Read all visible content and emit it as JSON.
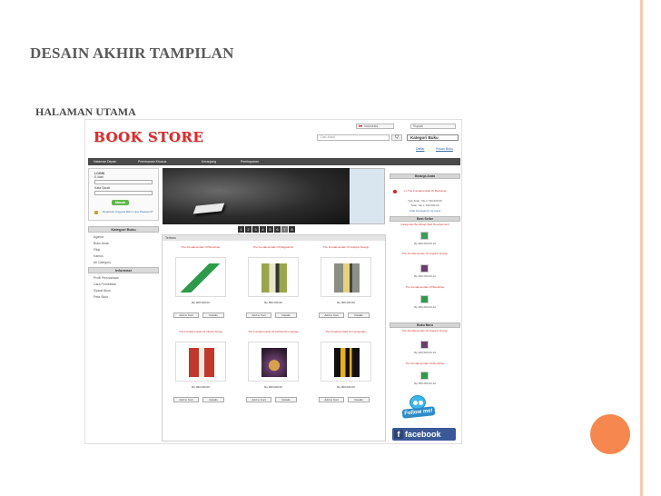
{
  "slide": {
    "title": "DESAIN AKHIR TAMPILAN",
    "subtitle": "HALAMAN UTAMA"
  },
  "store": {
    "logo": "BOOK STORE",
    "language": "Indonesia",
    "currency": "Rupiah",
    "search_placeholder": "Cari Judul",
    "search_button": "Q",
    "category_select": "Kategori Buku",
    "header_links": [
      "Daftar",
      "Pesan Buku"
    ],
    "nav": [
      "Halaman Depan",
      "Pemesanan Khusus",
      "Keranjang",
      "Pembayaran"
    ],
    "login": {
      "title": "LOGIN",
      "email_label": "E-Mail",
      "password_label": "Kata Sandi",
      "button": "Masuk",
      "register_text": "Registrasi Anggota Baru Lupa Password?"
    },
    "category_box": {
      "title": "Kategori Buku",
      "items": [
        "Agama",
        "Buku Anak",
        "Fiksi",
        "Kamus",
        "All Category"
      ]
    },
    "info_box": {
      "title": "Informasi",
      "items": [
        "Profil Perusahaan",
        "Cara Pembelian",
        "Syarat Akun",
        "Peta Situs"
      ]
    },
    "slideshow_pages": [
      "1",
      "2",
      "3",
      "4",
      "5",
      "6",
      "7",
      "8"
    ],
    "products_heading": "Terbaru",
    "products": [
      {
        "title": "The Fundamentals Of Bootstrap",
        "price": "Rp.000.000.00",
        "cover_color": "#2e9b4a"
      },
      {
        "title": "The Fundamentals Of Magical Art",
        "price": "Rp.000.000.00",
        "cover_color": "#9aa64b"
      },
      {
        "title": "The Fundamentals Of Graphic Design",
        "price": "Rp.000.000.00",
        "cover_color": "#8c8f86"
      },
      {
        "title": "The Fundamentals Of Interior Desig",
        "price": "Rp.000.000.00",
        "cover_color": "#c0392b"
      },
      {
        "title": "The Fundamentals Of Architecture Design",
        "price": "Rp.000.000.00",
        "cover_color": "#6b3f6d"
      },
      {
        "title": "The Fundamentals Of Typography",
        "price": "Rp.000.000.00",
        "cover_color": "#e6b01e"
      }
    ],
    "add_to_cart": "Add to Cart",
    "detail": "Details",
    "right": {
      "cart_title": "Belanja Anda",
      "cart_line": "1 x The Fundamentals Of Bootstrap",
      "subtotal": "Sub-Total : Rp.1.700.000.00",
      "total": "Total : Rp.1.700.000.00",
      "cart_link": "Lihat Keranjang | Ke Kasir",
      "bestseller_title": "Best Seller",
      "bestseller_items": [
        {
          "title": "Categories Bootstrap Web Development",
          "price": "Rp.000.000.00.12",
          "color": "#3a9d5a"
        },
        {
          "title": "The Fundamentals Of Graphic Design",
          "price": "Rp.000.000.00.12",
          "color": "#6b3f6d"
        },
        {
          "title": "The Fundamentals Of Bootstrap",
          "price": "Rp.000.000.00.12",
          "color": "#2e9b4a"
        }
      ],
      "new_title": "Buku Baru",
      "new_items": [
        {
          "title": "The Fundamentals Of Graphic Design",
          "price": "Rp.000.000.00.12",
          "color": "#6b3f6d"
        },
        {
          "title": "The Fundamentals Of Bootstrap",
          "price": "Rp.000.000.00.12",
          "color": "#2e9b4a"
        }
      ],
      "follow_text": "Follow me!",
      "facebook_text": "facebook",
      "facebook_letter": "f"
    }
  },
  "colors": {
    "accent_circle": "#f6874f",
    "rule": "#f4c8ad",
    "logo_red": "#e12a2a",
    "nav_bg": "#4a4a4a"
  }
}
